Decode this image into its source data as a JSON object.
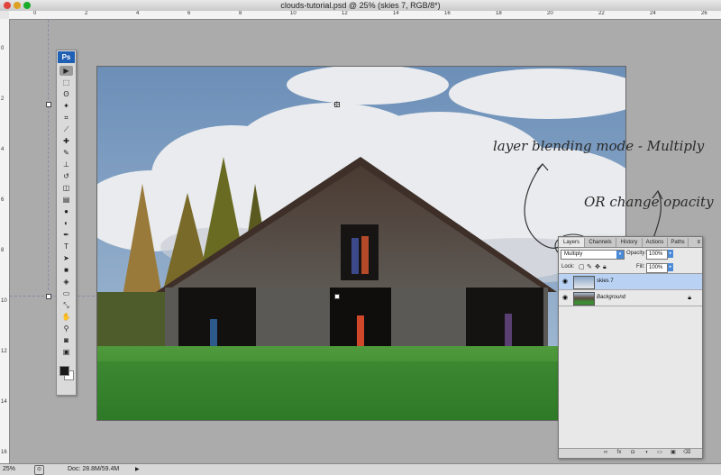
{
  "window": {
    "title": "clouds-tutorial.psd @ 25% (skies 7, RGB/8*)"
  },
  "rulers": {
    "top": [
      "0",
      "2",
      "4",
      "6",
      "8",
      "10",
      "12",
      "14",
      "16",
      "18",
      "20",
      "22",
      "24",
      "26"
    ],
    "left": [
      "0",
      "2",
      "4",
      "6",
      "8",
      "10",
      "12",
      "14",
      "16"
    ]
  },
  "toolbar": {
    "logo": "Ps",
    "tools": [
      {
        "name": "move-tool",
        "glyph": "▶"
      },
      {
        "name": "marquee-tool",
        "glyph": "⬚"
      },
      {
        "name": "lasso-tool",
        "glyph": "ʘ"
      },
      {
        "name": "magic-wand-tool",
        "glyph": "✦"
      },
      {
        "name": "crop-tool",
        "glyph": "⌗"
      },
      {
        "name": "eyedropper-tool",
        "glyph": "⟋"
      },
      {
        "name": "healing-tool",
        "glyph": "✚"
      },
      {
        "name": "brush-tool",
        "glyph": "✎"
      },
      {
        "name": "clone-stamp-tool",
        "glyph": "⊥"
      },
      {
        "name": "history-brush-tool",
        "glyph": "↺"
      },
      {
        "name": "eraser-tool",
        "glyph": "◫"
      },
      {
        "name": "gradient-tool",
        "glyph": "▤"
      },
      {
        "name": "blur-tool",
        "glyph": "●"
      },
      {
        "name": "dodge-tool",
        "glyph": "◐"
      },
      {
        "name": "pen-tool",
        "glyph": "✒"
      },
      {
        "name": "type-tool",
        "glyph": "T"
      },
      {
        "name": "path-selection-tool",
        "glyph": "➤"
      },
      {
        "name": "shape-tool",
        "glyph": "■"
      },
      {
        "name": "3d-rotate-tool",
        "glyph": "◈"
      },
      {
        "name": "note-tool",
        "glyph": "▭"
      },
      {
        "name": "eyedropper2-tool",
        "glyph": "⤡"
      },
      {
        "name": "hand-tool",
        "glyph": "✋"
      },
      {
        "name": "zoom-tool",
        "glyph": "⚲"
      },
      {
        "name": "quick-mask-tool",
        "glyph": "◙"
      },
      {
        "name": "screen-mode-tool",
        "glyph": "▣"
      }
    ],
    "fg_color": "#1a1a1a",
    "bg_color": "#ffffff"
  },
  "layers_panel": {
    "tabs": [
      "Layers",
      "Channels",
      "History",
      "Actions",
      "Paths"
    ],
    "blend_mode": "Multiply",
    "opacity_label": "Opacity:",
    "opacity_value": "100%",
    "lock_label": "Lock:",
    "fill_label": "Fill:",
    "fill_value": "100%",
    "layers": [
      {
        "name": "skies 7",
        "selected": true
      },
      {
        "name": "Background",
        "selected": false,
        "locked": true
      }
    ],
    "footer_icons": [
      "link-icon",
      "fx-icon",
      "mask-icon",
      "adjustment-icon",
      "group-icon",
      "new-layer-icon",
      "trash-icon"
    ]
  },
  "annotations": {
    "blend": "layer blending mode - Multiply",
    "opacity": "OR change opacity"
  },
  "status": {
    "zoom": "25%",
    "doc": "Doc: 28.8M/59.4M"
  },
  "colors": {
    "selected_layer": "#b9d2f4",
    "accent": "#4a8ad8",
    "ps_blue": "#1f5fb4"
  }
}
